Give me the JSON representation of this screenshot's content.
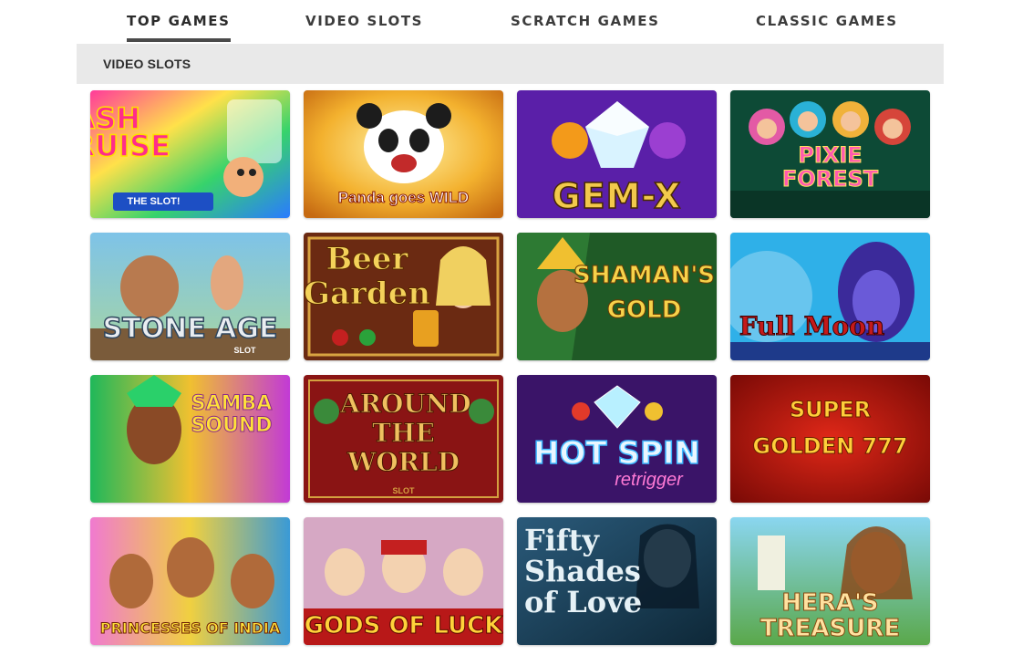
{
  "tabs": [
    {
      "label": "TOP GAMES",
      "active": true
    },
    {
      "label": "VIDEO SLOTS",
      "active": false
    },
    {
      "label": "SCRATCH GAMES",
      "active": false
    },
    {
      "label": "CLASSIC GAMES",
      "active": false
    }
  ],
  "section": {
    "title": "VIDEO SLOTS"
  },
  "games": [
    {
      "title": "CASH CRUISE",
      "subtitle": "THE SLOT!"
    },
    {
      "title": "Panda goes WILD"
    },
    {
      "title": "GEM-X"
    },
    {
      "title": "PIXIE FOREST"
    },
    {
      "title": "STONE AGE",
      "subtitle": "SLOT"
    },
    {
      "title": "Beer Garden"
    },
    {
      "title": "SHAMAN'S GOLD"
    },
    {
      "title": "Full Moon"
    },
    {
      "title": "SAMBA SOUND"
    },
    {
      "title": "AROUND THE WORLD",
      "subtitle": "SLOT"
    },
    {
      "title": "HOT SPIN",
      "subtitle": "retrigger"
    },
    {
      "title": "SUPER GOLDEN 777"
    },
    {
      "title": "PRINCESSES OF INDIA"
    },
    {
      "title": "GODS OF LUCK"
    },
    {
      "title": "Fifty Shades of Love"
    },
    {
      "title": "HERA'S TREASURE"
    }
  ],
  "colors": {
    "tab_text": "#3c3c3c",
    "underline": "#4a4a4a",
    "section_bg": "#e9e9e9"
  }
}
